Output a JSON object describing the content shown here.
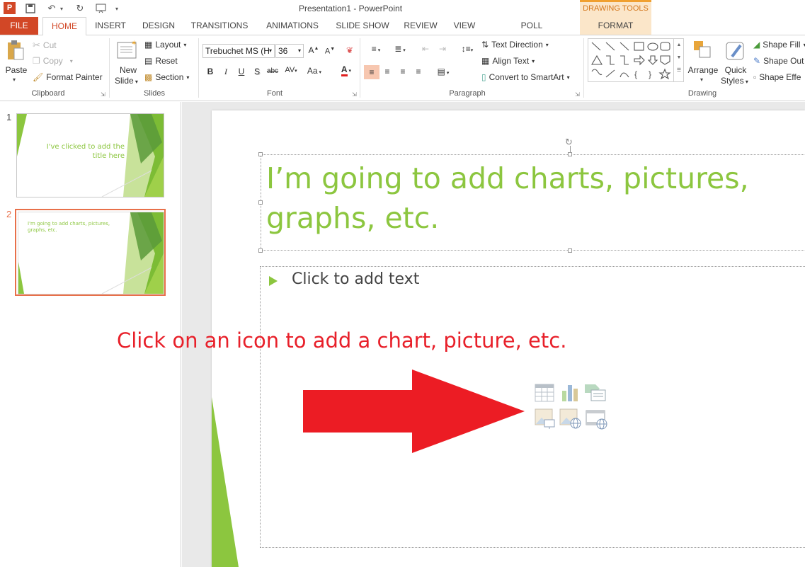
{
  "window": {
    "title": "Presentation1 - PowerPoint",
    "contextual_tab_group": "DRAWING TOOLS"
  },
  "tabs": [
    "FILE",
    "HOME",
    "INSERT",
    "DESIGN",
    "TRANSITIONS",
    "ANIMATIONS",
    "SLIDE SHOW",
    "REVIEW",
    "VIEW",
    "POLL EVERYWHERE",
    "FORMAT"
  ],
  "active_tab": "HOME",
  "clipboard": {
    "label": "Clipboard",
    "paste": "Paste",
    "cut": "Cut",
    "copy": "Copy",
    "format_painter": "Format Painter"
  },
  "slides_group": {
    "label": "Slides",
    "new_slide_1": "New",
    "new_slide_2": "Slide",
    "layout": "Layout",
    "reset": "Reset",
    "section": "Section"
  },
  "font": {
    "label": "Font",
    "family": "Trebuchet MS (H",
    "size": "36",
    "bold": "B",
    "italic": "I",
    "underline": "U",
    "shadow": "S",
    "strike": "abc",
    "spacing": "AV",
    "case": "Aa",
    "color": "A"
  },
  "paragraph": {
    "label": "Paragraph",
    "text_direction": "Text Direction",
    "align_text": "Align Text",
    "convert_smartart": "Convert to SmartArt"
  },
  "drawing": {
    "label": "Drawing",
    "arrange": "Arrange",
    "quick_styles_1": "Quick",
    "quick_styles_2": "Styles",
    "shape_fill": "Shape Fill",
    "shape_outline": "Shape Out",
    "shape_effects": "Shape Effe"
  },
  "thumbnails": [
    {
      "number": "1",
      "text": "I've clicked to add the title here"
    },
    {
      "number": "2",
      "text": "I'm going to add charts, pictures, graphs, etc."
    }
  ],
  "slide": {
    "title": "I’m going to add charts, pictures, graphs, etc.",
    "body_placeholder": "Click to add text",
    "annotation": "Click on an icon to add a chart, picture, etc."
  },
  "colors": {
    "file_tab": "#d24726",
    "accent_green": "#8cc63f",
    "annotation_red": "#e8202a",
    "selected_thumb_border": "#e8704a"
  },
  "content_icons": [
    "table-icon",
    "chart-icon",
    "smartart-icon",
    "pictures-icon",
    "online-pictures-icon",
    "video-icon"
  ]
}
